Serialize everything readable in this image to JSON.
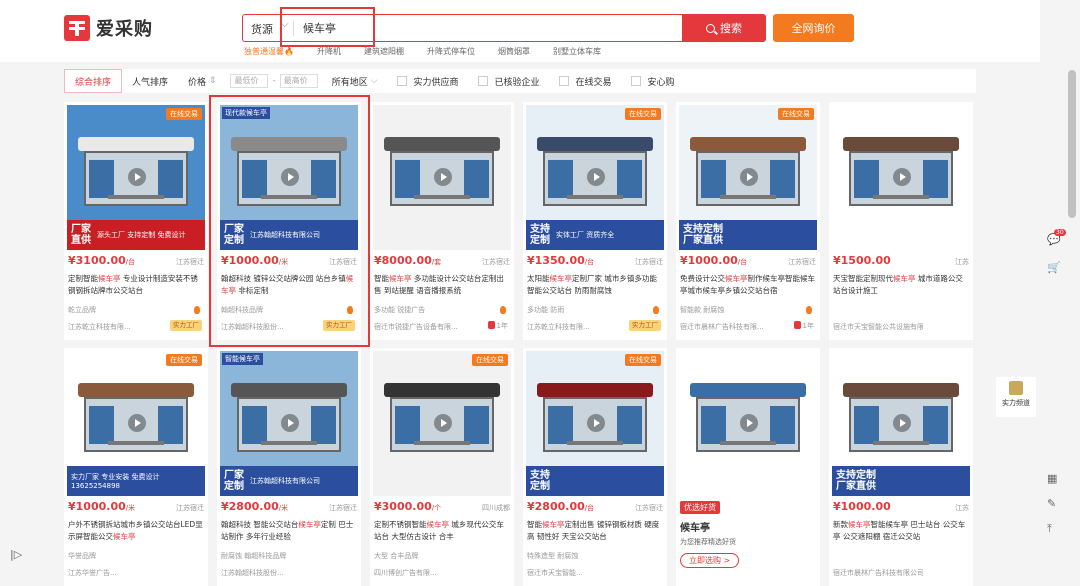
{
  "header": {
    "logo_text": "爱采购",
    "search_category": "货源",
    "search_value": "候车亭",
    "search_button": "搜索",
    "inquiry_button": "全网询价",
    "hotwords": [
      "独普通温馨🔥",
      "升降机",
      "建筑遮阳棚",
      "升降式停车位",
      "烟筒烟罩",
      "别墅立体车库"
    ]
  },
  "filters": {
    "sort_comprehensive": "综合排序",
    "sort_popular": "人气排序",
    "price_label": "价格",
    "price_min": "最低价",
    "price_max": "最高价",
    "region": "所有地区",
    "supply_power": "实力供应商",
    "verified": "已核验企业",
    "online_trade": "在线交易",
    "safe_buy": "安心购"
  },
  "colors": {
    "accent": "#e4393c",
    "orange": "#f47a20",
    "blue_banner": "#2b4f9e"
  },
  "products": [
    {
      "price": "¥3100.00",
      "unit": "/台",
      "loc": "江苏宿迁",
      "t1": "定制智能",
      "kw": "候车亭",
      "t2": " 专业设计制造安装不锈钢钢拆站牌市公交站台",
      "tags": "乾立品牌",
      "company": "江苏乾立科技有限...",
      "badge": "实力工厂",
      "online": "在线交易",
      "banner1": "厂家",
      "banner2": "直供",
      "banner_sub": "源头工厂 支持定制 免费设计"
    },
    {
      "price": "¥1000.00",
      "unit": "/米",
      "loc": "江苏宿迁",
      "t1": "翰超科技 镀锌公交站牌公园 站台乡镇",
      "kw": "候车亭",
      "t2": " 非标定制",
      "tags": "翰超科技品牌",
      "company": "江苏翰超科技股份...",
      "badge": "实力工厂",
      "banner1": "厂家",
      "banner2": "定制",
      "banner_sub": "江苏翰超科技有限公司",
      "label": "现代款候车亭"
    },
    {
      "price": "¥8000.00",
      "unit": "/套",
      "loc": "江苏宿迁",
      "t1": "智能",
      "kw": "候车亭",
      "t2": " 多功能设计公交站台定制出售 到站提醒 语音播报系统",
      "tags": "多功能 锐捷广告",
      "company": "宿迁市锐捷广告设备有限...",
      "yr": "1年"
    },
    {
      "price": "¥1350.00",
      "unit": "/台",
      "loc": "江苏宿迁",
      "t1": "太阳能",
      "kw": "候车亭",
      "t2": "定制厂家 城市乡镇多功能智能公交站台 防雨耐腐蚀",
      "tags": "多功能 防雨",
      "company": "江苏乾立科技有限...",
      "badge": "实力工厂",
      "online": "在线交易",
      "banner1": "支持",
      "banner2": "定制",
      "banner_sub": "实体工厂 资质齐全"
    },
    {
      "price": "¥1000.00",
      "unit": "/台",
      "loc": "江苏宿迁",
      "t1": "免费设计公交",
      "kw": "候车亭",
      "t2": "制作候车亭智能候车亭城市候车亭乡镇公交站台宿",
      "tags": "智能款 耐腐蚀",
      "company": "宿迁市晨林广告科技有限...",
      "yr": "1年",
      "online": "在线交易",
      "banner1": "支持定制",
      "banner2": "厂家直供"
    },
    {
      "price": "¥1500.00",
      "unit": "",
      "loc": "江苏",
      "t1": "天宝智能定制现代",
      "kw": "候车亭",
      "t2": " 城市道路公交站台设计施工",
      "tags": "",
      "company": "宿迁市天宝智能公共设施有限公司"
    },
    {
      "price": "¥1000.00",
      "unit": "/米",
      "loc": "江苏宿迁",
      "t1": "户外不锈钢拆站城市乡镇公交站台LED显示屏智能公交",
      "kw": "候车亭",
      "t2": "",
      "tags": "华誉品牌",
      "company": "江苏华誉广告...",
      "online": "在线交易",
      "banner_sub": "实力厂家 专业安装 免费设计 13625254898"
    },
    {
      "price": "¥2800.00",
      "unit": "/米",
      "loc": "江苏宿迁",
      "t1": "翰超科技 智能公交站台",
      "kw": "候车亭",
      "t2": "定制 巴士站制作 多年行业经验",
      "tags": "耐腐蚀 翰超科技品牌",
      "company": "江苏翰超科技股份...",
      "banner1": "厂家",
      "banner2": "定制",
      "banner_sub": "江苏翰超科技有限公司",
      "label": "智能候车亭"
    },
    {
      "price": "¥3000.00",
      "unit": "/个",
      "loc": "四川成都",
      "t1": "定制不锈钢智能",
      "kw": "候车亭",
      "t2": " 城乡现代公交车站台 大型仿古设计 合丰",
      "tags": "大型 合丰品牌",
      "company": "四川博创广告有限...",
      "online": "在线交易"
    },
    {
      "price": "¥2800.00",
      "unit": "/台",
      "loc": "江苏宿迁",
      "t1": "智能",
      "kw": "候车亭",
      "t2": "定制出售 镀锌钢板材质 硬度高 韧性好 天宝公交站台",
      "tags": "特殊造型 耐腐蚀",
      "company": "宿迁市天宝智能...",
      "online": "在线交易",
      "banner1": "支持",
      "banner2": "定制"
    },
    {
      "price": "优选好货",
      "unit": "",
      "loc": "",
      "t1": "",
      "kw": "候车亭",
      "t2": "",
      "tags": "为您推荐精选好货",
      "company": "立即选购 >",
      "special": true
    },
    {
      "price": "¥1000.00",
      "unit": "",
      "loc": "江苏",
      "t1": "新款",
      "kw": "候车亭",
      "t2": "智能候车亭 巴士站台 公交车亭 公交遮阳棚 宿迁公交站",
      "tags": "",
      "company": "宿迁市晨林广告科技有限公司",
      "banner1": "支持定制",
      "banner2": "厂家直供"
    }
  ],
  "sidebar": {
    "sticky_label": "实力频道",
    "cart_count": "30"
  }
}
